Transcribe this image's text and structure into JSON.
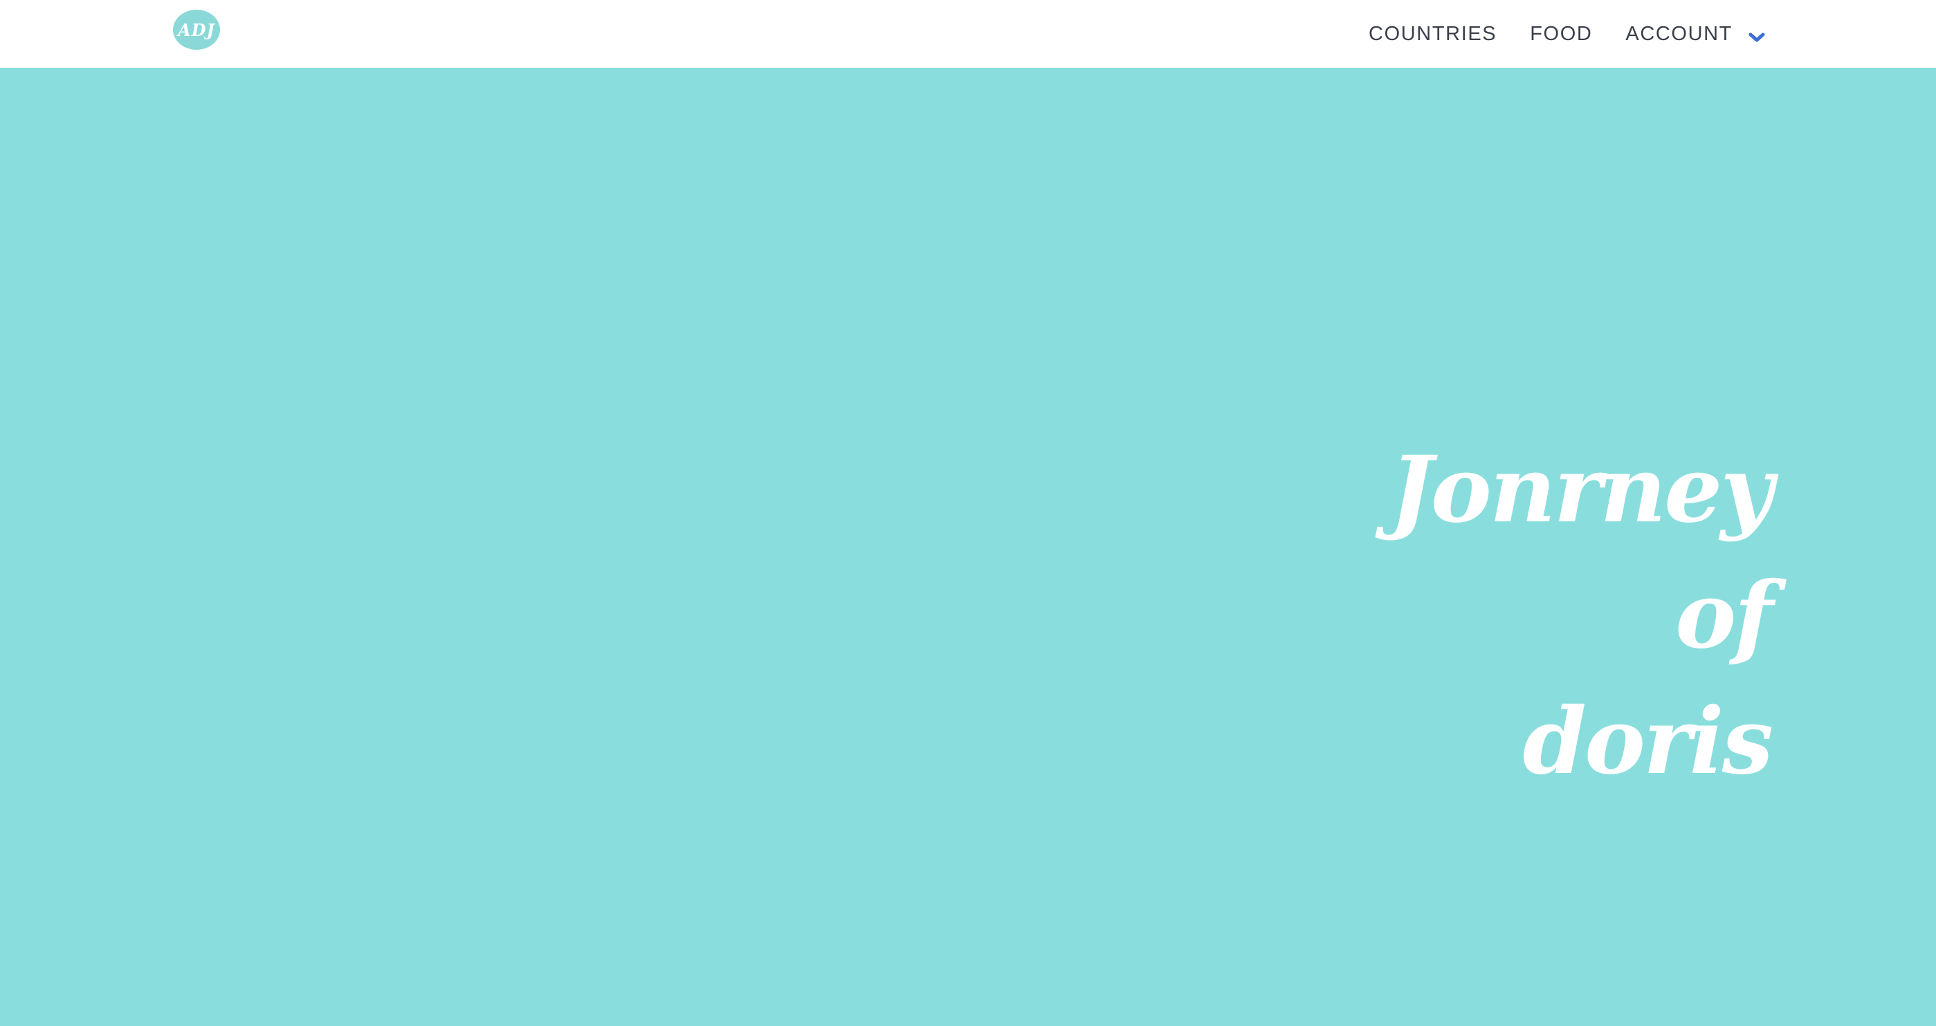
{
  "header": {
    "logo_text": "ADJ",
    "nav": [
      {
        "label": "COUNTRIES"
      },
      {
        "label": "FOOD"
      },
      {
        "label": "ACCOUNT"
      }
    ]
  },
  "hero": {
    "title_line1": "Jonrney of",
    "title_line2": "doris"
  },
  "colors": {
    "background": "#89dedd",
    "navbar": "#ffffff",
    "nav_text": "#3a3f4a",
    "chevron": "#3b6fd6",
    "hero_text": "#ffffff"
  },
  "icons": {
    "account_dropdown": "chevron-down-icon"
  }
}
